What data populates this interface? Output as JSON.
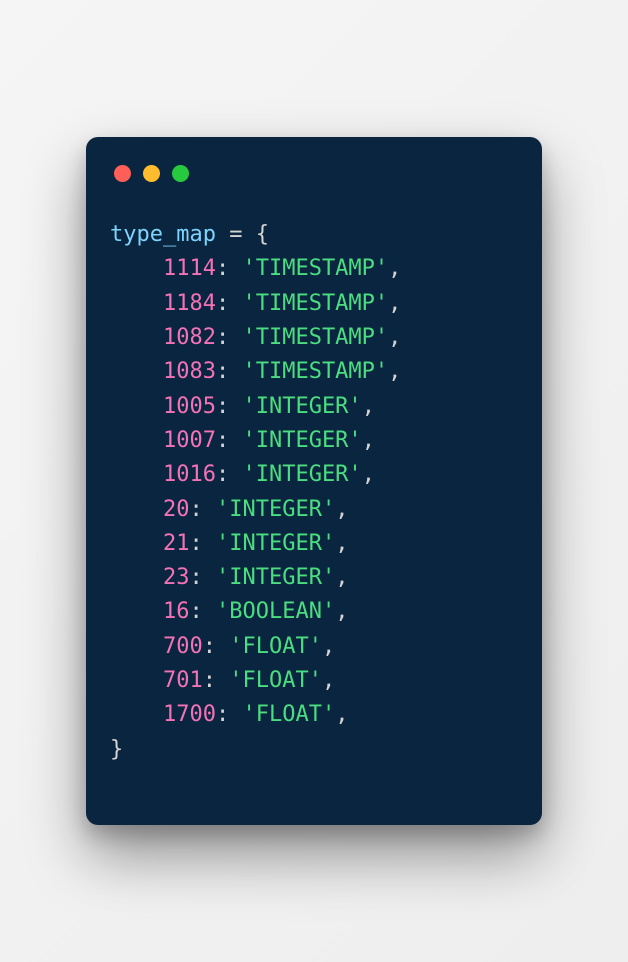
{
  "window": {
    "traffic_lights": [
      "red",
      "yellow",
      "green"
    ]
  },
  "code": {
    "var_name": "type_map",
    "equals": " = ",
    "open_brace": "{",
    "close_brace": "}",
    "entries": [
      {
        "key": "1114",
        "value": "'TIMESTAMP'"
      },
      {
        "key": "1184",
        "value": "'TIMESTAMP'"
      },
      {
        "key": "1082",
        "value": "'TIMESTAMP'"
      },
      {
        "key": "1083",
        "value": "'TIMESTAMP'"
      },
      {
        "key": "1005",
        "value": "'INTEGER'"
      },
      {
        "key": "1007",
        "value": "'INTEGER'"
      },
      {
        "key": "1016",
        "value": "'INTEGER'"
      },
      {
        "key": "20",
        "value": "'INTEGER'"
      },
      {
        "key": "21",
        "value": "'INTEGER'"
      },
      {
        "key": "23",
        "value": "'INTEGER'"
      },
      {
        "key": "16",
        "value": "'BOOLEAN'"
      },
      {
        "key": "700",
        "value": "'FLOAT'"
      },
      {
        "key": "701",
        "value": "'FLOAT'"
      },
      {
        "key": "1700",
        "value": "'FLOAT'"
      }
    ],
    "indent": "    ",
    "colon": ":",
    "space_after_colon": " ",
    "comma": ","
  }
}
